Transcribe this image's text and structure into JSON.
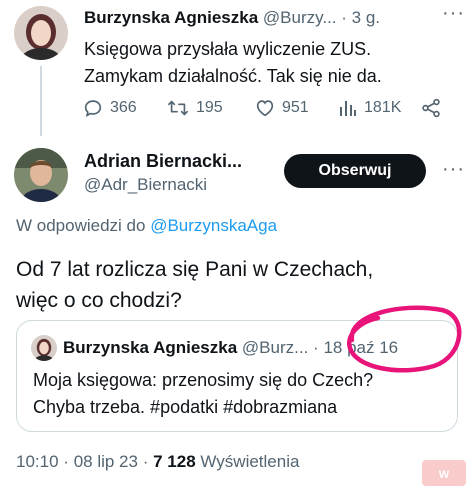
{
  "tweet1": {
    "author_name": "Burzynska Agnieszka",
    "author_handle": "@Burzy...",
    "separator": "·",
    "time": "3 g.",
    "more": "···",
    "text_line1": "Księgowa przysłała wyliczenie ZUS.",
    "text_line2": "Zamykam działalność. Tak się nie da.",
    "replies": "366",
    "retweets": "195",
    "likes": "951",
    "views": "181K"
  },
  "tweet2": {
    "author_name": "Adrian Biernacki...",
    "author_handle": "@Adr_Biernacki",
    "follow_label": "Obserwuj",
    "more": "···",
    "reply_prefix": "W odpowiedzi do ",
    "reply_handle": "@BurzynskaAga",
    "text_line1": "Od 7 lat rozlicza się Pani w Czechach,",
    "text_line2": "więc o co chodzi?",
    "quote": {
      "author_name": "Burzynska Agnieszka",
      "author_handle": "@Burz...",
      "separator": "·",
      "date": "18 paź 16",
      "text_line1": "Moja księgowa: przenosimy się do Czech?",
      "text_line2": "Chyba trzeba. #podatki #dobrazmiana"
    },
    "time": "10:10",
    "date": "08 lip 23",
    "views_count": "7 128",
    "views_label": "Wyświetlenia"
  },
  "colors": {
    "text": "#0f1419",
    "secondary": "#536471",
    "link": "#1d9bf0",
    "button_bg": "#0f1419",
    "highlight_circle": "#e8147a"
  },
  "icons": [
    "reply-icon",
    "retweet-icon",
    "like-icon",
    "views-icon",
    "share-icon",
    "more-icon"
  ]
}
